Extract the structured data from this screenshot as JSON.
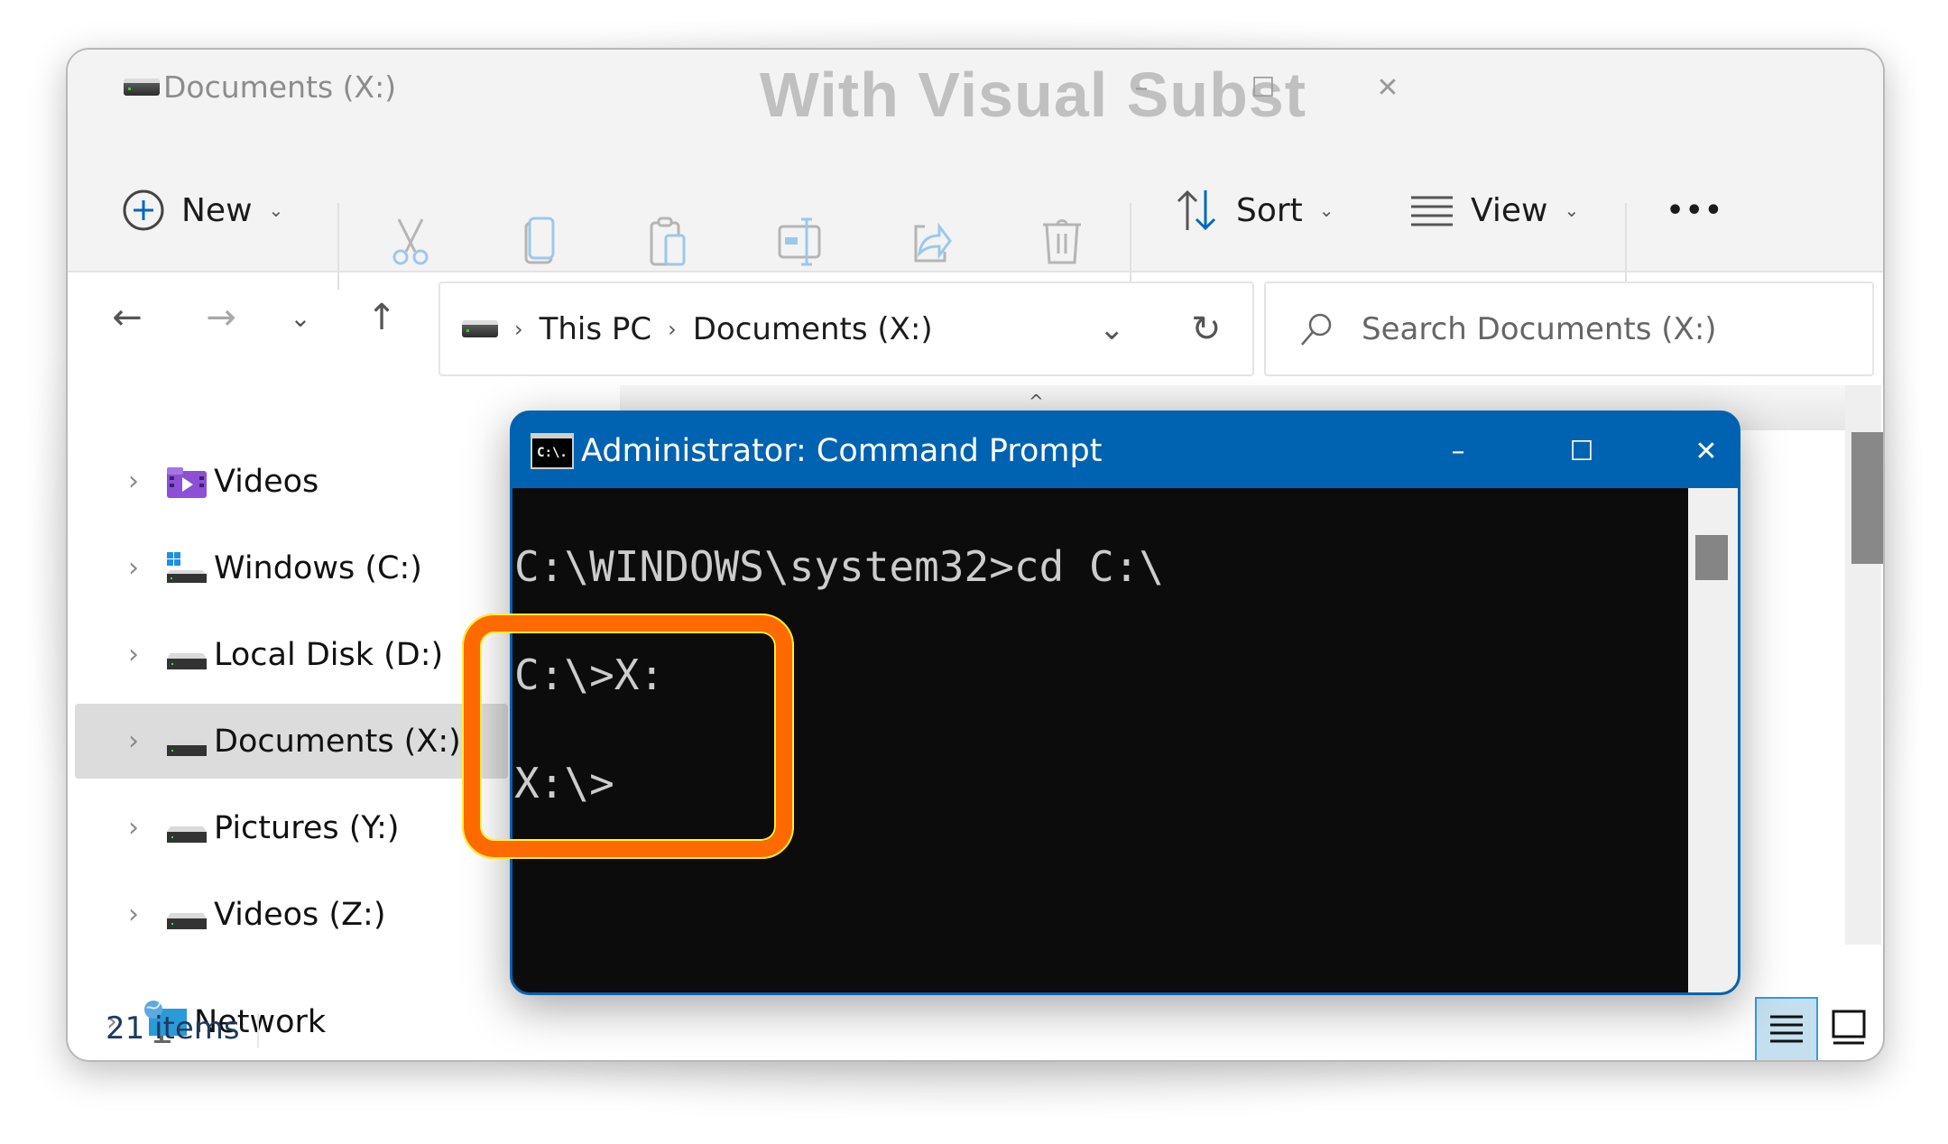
{
  "explorer": {
    "window_title": "Documents (X:)",
    "banner": "With Visual Subst",
    "caption_buttons": {
      "minimize": "–",
      "maximize": "☐",
      "close": "✕"
    },
    "toolbar": {
      "new_label": "New",
      "sort_label": "Sort",
      "view_label": "View",
      "more_label": "•••",
      "icons": [
        "cut-icon",
        "copy-icon",
        "paste-icon",
        "rename-icon",
        "share-icon",
        "delete-icon"
      ]
    },
    "nav": {
      "back": "←",
      "forward": "→",
      "recent": "⌄",
      "up": "↑"
    },
    "address": {
      "crumbs": [
        "This PC",
        "Documents (X:)"
      ]
    },
    "search": {
      "placeholder": "Search Documents (X:)"
    },
    "sidebar": {
      "items": [
        {
          "label": "Videos",
          "icon": "videos-folder-icon"
        },
        {
          "label": "Windows (C:)",
          "icon": "windows-drive-icon"
        },
        {
          "label": "Local Disk (D:)",
          "icon": "drive-icon"
        },
        {
          "label": "Documents (X:)",
          "icon": "drive-icon",
          "selected": true
        },
        {
          "label": "Pictures (Y:)",
          "icon": "drive-icon"
        },
        {
          "label": "Videos (Z:)",
          "icon": "drive-icon"
        },
        {
          "label": "Network",
          "icon": "network-icon"
        }
      ]
    },
    "status": {
      "item_count": "21 items"
    }
  },
  "cmd": {
    "title": "Administrator: Command Prompt",
    "icon_text": "C:\\.",
    "caption_buttons": {
      "minimize": "–",
      "maximize": "☐",
      "close": "✕"
    },
    "lines": [
      "C:\\WINDOWS\\system32>cd C:\\",
      "C:\\>X:",
      "X:\\>"
    ]
  },
  "annotation": {
    "color": "#ff6a00"
  }
}
